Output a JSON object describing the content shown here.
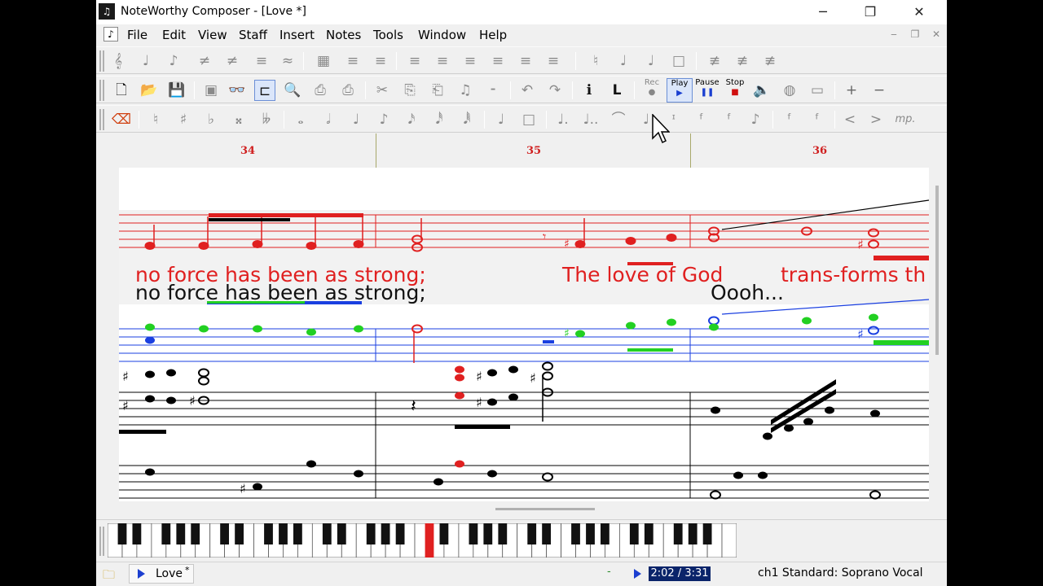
{
  "window": {
    "title": "NoteWorthy Composer - [Love *]",
    "controls": {
      "minimize": "─",
      "restore": "❐",
      "close": "✕"
    }
  },
  "menu": {
    "items": [
      "File",
      "Edit",
      "View",
      "Staff",
      "Insert",
      "Notes",
      "Tools",
      "Window",
      "Help"
    ],
    "mdi_controls": {
      "minimize": "‒",
      "restore": "❐",
      "close": "✕"
    }
  },
  "toolbar_playback": {
    "rec": "Rec",
    "play": "Play",
    "pause": "Pause",
    "stop": "Stop"
  },
  "ruler": {
    "measures": [
      "34",
      "35",
      "36"
    ]
  },
  "score": {
    "lyrics_line1_a": "no force has been as strong;",
    "lyrics_line2": "no force has been as strong;",
    "lyrics_line1_b": "The love of God",
    "lyrics_line1_c": "trans-forms th",
    "lyrics_line2_b": "Oooh..."
  },
  "status": {
    "doc_tab": "Love",
    "doc_tab_mark": "*",
    "dash": "-",
    "time": "2:02 / 3:31",
    "staff_info": "ch1 Standard: Soprano Vocal"
  },
  "colors": {
    "active_staff": "#e02020",
    "secondary_staff": "#1a3fe0",
    "highlight_notes": "#22d022",
    "selection_bar": "#1a3fe0"
  },
  "icons": [
    "new-document-icon",
    "open-folder-icon",
    "save-icon",
    "print-icon",
    "zoom-icon",
    "undo-icon",
    "redo-icon",
    "info-icon",
    "speaker-icon",
    "globe-icon",
    "plus-icon",
    "minus-icon"
  ]
}
